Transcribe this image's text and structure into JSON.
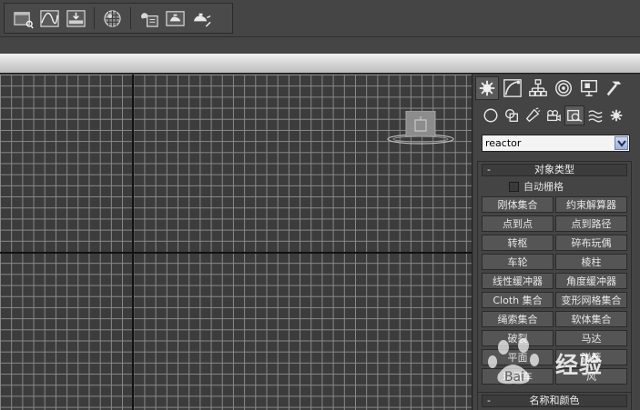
{
  "toolbar": {
    "icons": [
      "scene-explorer-icon",
      "curve-editor-icon",
      "render-setup-icon",
      "material-editor-icon",
      "render-frame-icon",
      "render-icon",
      "render-production-icon"
    ]
  },
  "command_panel": {
    "main_tabs": [
      "create-tab",
      "modify-tab",
      "hierarchy-tab",
      "motion-tab",
      "display-tab",
      "utilities-tab"
    ],
    "sub_tabs": [
      "geometry-tab",
      "shapes-tab",
      "lights-tab",
      "cameras-tab",
      "helpers-tab",
      "space-warps-tab",
      "systems-tab"
    ],
    "category_select": {
      "value": "reactor"
    },
    "object_type_rollout": {
      "toggle": "-",
      "title": "对象类型",
      "autogrid_label": "自动栅格",
      "buttons": [
        "刚体集合",
        "约束解算器",
        "点到点",
        "点到路径",
        "转枢",
        "碎布玩偶",
        "车轮",
        "棱柱",
        "线性缓冲器",
        "角度缓冲器",
        "Cloth 集合",
        "变形网格集合",
        "绳索集合",
        "软体集合",
        "破裂",
        "马达",
        "平面",
        "弹簧",
        "玩具车",
        "风"
      ]
    },
    "name_color_rollout": {
      "toggle": "-",
      "title": "名称和颜色"
    }
  },
  "watermark": {
    "text": "经验"
  },
  "colors": {
    "background": "#3a3a3a",
    "grid_line": "#8a8a8a",
    "axis_line": "#111111",
    "button": "#555555",
    "dropdown_arrow": "#9fb1d9"
  }
}
